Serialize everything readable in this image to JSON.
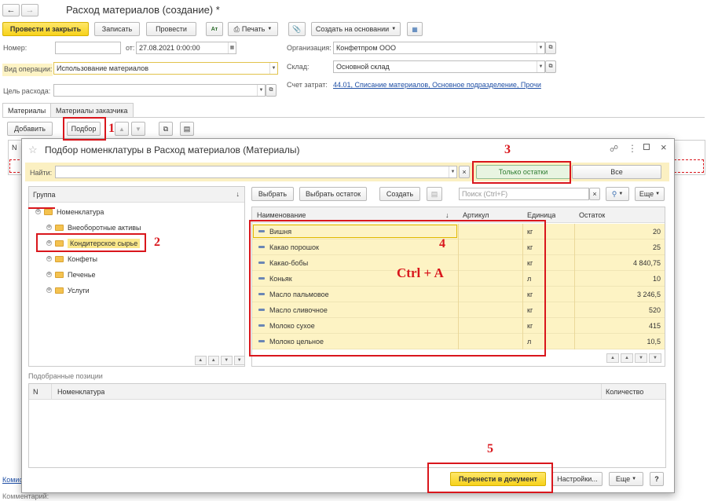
{
  "window": {
    "title": "Расход материалов (создание) *"
  },
  "toolbar": {
    "post_close": "Провести и закрыть",
    "save": "Записать",
    "post": "Провести",
    "print": "Печать",
    "create_based": "Создать на основании"
  },
  "form": {
    "number_label": "Номер:",
    "number_value": "",
    "date_label": "от:",
    "date_value": "27.08.2021  0:00:00",
    "org_label": "Организация:",
    "org_value": "Конфетпром ООО",
    "warehouse_label": "Склад:",
    "warehouse_value": "Основной склад",
    "optype_label": "Вид операции:",
    "optype_value": "Использование материалов",
    "purpose_label": "Цель расхода:",
    "purpose_value": "",
    "account_label": "Счет затрат:",
    "account_value": "44.01, Списание материалов, Основное подразделение, Прочи"
  },
  "tabs": [
    "Материалы",
    "Материалы заказчика"
  ],
  "table_toolbar": {
    "add": "Добавить",
    "pick": "Подбор"
  },
  "bg_table": {
    "col_n": "N"
  },
  "bottom_left": {
    "link": "Комис",
    "comment": "Комментарий:"
  },
  "dialog": {
    "title": "Подбор номенклатуры в Расход материалов (Материалы)",
    "find_label": "Найти:",
    "find_value": "",
    "only_remains": "Только остатки",
    "all": "Все",
    "group_header": "Группа",
    "group_sort": "↓",
    "tree": [
      {
        "label": "Номенклатура",
        "level": 0,
        "selected": false
      },
      {
        "label": "Внеоборотные активы",
        "level": 1,
        "selected": false
      },
      {
        "label": "Кондитерское сырье",
        "level": 1,
        "selected": true
      },
      {
        "label": "Конфеты",
        "level": 1,
        "selected": false
      },
      {
        "label": "Печенье",
        "level": 1,
        "selected": false
      },
      {
        "label": "Услуги",
        "level": 1,
        "selected": false
      }
    ],
    "list_toolbar": {
      "choose": "Выбрать",
      "choose_remain": "Выбрать остаток",
      "create": "Создать",
      "search_placeholder": "Поиск (Ctrl+F)",
      "more": "Еще"
    },
    "columns": {
      "name": "Наименование",
      "article": "Артикул",
      "unit": "Единица",
      "remain": "Остаток"
    },
    "items": [
      {
        "name": "Вишня",
        "article": "",
        "unit": "кг",
        "remain": "20"
      },
      {
        "name": "Какао порошок",
        "article": "",
        "unit": "кг",
        "remain": "25"
      },
      {
        "name": "Какао-бобы",
        "article": "",
        "unit": "кг",
        "remain": "4 840,75"
      },
      {
        "name": "Коньяк",
        "article": "",
        "unit": "л",
        "remain": "10"
      },
      {
        "name": "Масло пальмовое",
        "article": "",
        "unit": "кг",
        "remain": "3 246,5"
      },
      {
        "name": "Масло сливочное",
        "article": "",
        "unit": "кг",
        "remain": "520"
      },
      {
        "name": "Молоко сухое",
        "article": "",
        "unit": "кг",
        "remain": "415"
      },
      {
        "name": "Молоко цельное",
        "article": "",
        "unit": "л",
        "remain": "10,5"
      }
    ],
    "selected_section": "Подобранные позиции",
    "selected_columns": {
      "n": "N",
      "name": "Номенклатура",
      "qty": "Количество"
    },
    "transfer": "Перенести в документ",
    "settings": "Настройки...",
    "more": "Еще",
    "help": "?"
  },
  "annotations": {
    "n1": "1",
    "n2": "2",
    "n3": "3",
    "n4": "4",
    "n5": "5",
    "hotkey": "Ctrl + A"
  },
  "colors": {
    "accent_yellow": "#f7d21b",
    "annotation_red": "#d9161c",
    "row_yellow": "#fdf3c4",
    "link_blue": "#1f4fa5"
  }
}
